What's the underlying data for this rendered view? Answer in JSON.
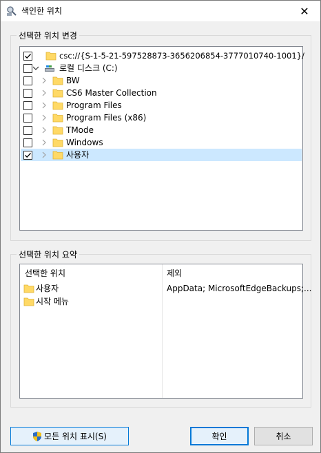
{
  "window": {
    "title": "색인한 위치",
    "icon": "indexing-options-icon",
    "close_glyph": "✕"
  },
  "change_group": {
    "label": "선택한 위치 변경",
    "items": [
      {
        "label": "csc://{S-1-5-21-597528873-3656206854-3777010740-1001}/",
        "checked": true,
        "has_expander": false,
        "icon": "folder-icon"
      },
      {
        "label": "로컬 디스크 (C:)",
        "checked": false,
        "has_expander": true,
        "expanded": true,
        "icon": "drive-icon"
      },
      {
        "label": "BW",
        "checked": false,
        "has_expander": true,
        "icon": "folder-icon"
      },
      {
        "label": "CS6 Master Collection",
        "checked": false,
        "has_expander": true,
        "icon": "folder-icon"
      },
      {
        "label": "Program Files",
        "checked": false,
        "has_expander": true,
        "icon": "folder-icon"
      },
      {
        "label": "Program Files (x86)",
        "checked": false,
        "has_expander": true,
        "icon": "folder-icon"
      },
      {
        "label": "TMode",
        "checked": false,
        "has_expander": true,
        "icon": "folder-icon"
      },
      {
        "label": "Windows",
        "checked": false,
        "has_expander": true,
        "icon": "folder-icon"
      },
      {
        "label": "사용자",
        "checked": true,
        "has_expander": true,
        "icon": "folder-icon",
        "selected": true
      }
    ]
  },
  "summary_group": {
    "label": "선택한 위치 요약",
    "columns": [
      "선택한 위치",
      "제외"
    ],
    "rows": [
      {
        "location": "사용자",
        "exclude": "AppData; MicrosoftEdgeBackups;..."
      },
      {
        "location": "시작 메뉴",
        "exclude": ""
      }
    ]
  },
  "buttons": {
    "show_all": "모든 위치 표시(S)",
    "ok": "확인",
    "cancel": "취소"
  },
  "colors": {
    "selection": "#cce8ff",
    "folder": "#ffd966",
    "accent": "#0078d7"
  }
}
